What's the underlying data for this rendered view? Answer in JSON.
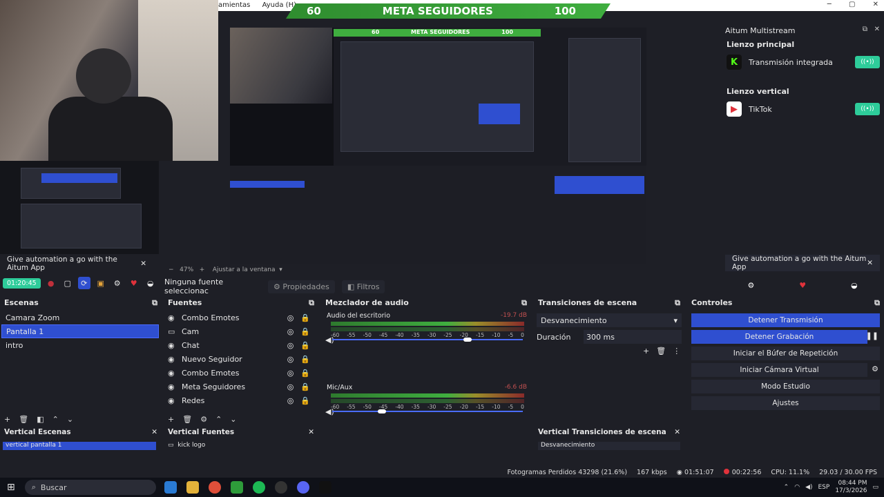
{
  "titlebar": {
    "menu": [
      "amientas",
      "Ayuda (H)"
    ],
    "min": "─",
    "max": "▢",
    "close": "✕"
  },
  "meta_banner": {
    "current": "60",
    "title": "META SEGUIDORES",
    "goal": "100"
  },
  "preview_meta": {
    "current": "60",
    "title": "META SEGUIDORES",
    "goal": "100"
  },
  "aitum": {
    "title": "Aitum Multistream",
    "main_canvas": "Lienzo principal",
    "main_item": "Transmisión integrada",
    "vertical_canvas": "Lienzo vertical",
    "vertical_item": "TikTok",
    "promo": "Give automation a go with the Aitum App",
    "toggle_icon": "((•))"
  },
  "left_promo": "Give automation a go with the Aitum App",
  "left_toolbar": {
    "live_time": "01:20:45"
  },
  "zoom": {
    "percent": "47%",
    "fit": "Ajustar a la ventana"
  },
  "source_bar": {
    "no_source": "Ninguna fuente seleccionac",
    "properties": "Propiedades",
    "filters": "Filtros"
  },
  "scenes": {
    "title": "Escenas",
    "items": [
      "Camara Zoom",
      "Pantalla 1",
      "intro"
    ],
    "selected": 1
  },
  "sources": {
    "title": "Fuentes",
    "items": [
      "Combo Emotes",
      "Cam",
      "Chat",
      "Nuevo Seguidor",
      "Combo Emotes",
      "Meta Seguidores",
      "Redes"
    ]
  },
  "mixer": {
    "title": "Mezclador de audio",
    "tracks": [
      {
        "name": "Audio del escritorio",
        "db": "-19.7 dB",
        "level": 0.72
      },
      {
        "name": "Mic/Aux",
        "db": "-6.6 dB",
        "level": 0.25
      }
    ],
    "ticks": [
      "-60",
      "-55",
      "-50",
      "-45",
      "-40",
      "-35",
      "-30",
      "-25",
      "-20",
      "-15",
      "-10",
      "-5",
      "0"
    ]
  },
  "transitions": {
    "title": "Transiciones de escena",
    "type": "Desvanecimiento",
    "duration_label": "Duración",
    "duration": "300 ms"
  },
  "controls": {
    "title": "Controles",
    "buttons": [
      "Detener Transmisión",
      "Detener Grabación",
      "Iniciar el Búfer de Repetición",
      "Iniciar Cámara Virtual",
      "Modo Estudio",
      "Ajustes"
    ]
  },
  "vertical": {
    "scenes_title": "Vertical Escenas",
    "scene_item": "vertical pantalla 1",
    "sources_title": "Vertical Fuentes",
    "source_item": "kick logo",
    "transitions_title": "Vertical Transiciones de escena",
    "transition_item": "Desvanecimiento"
  },
  "status": {
    "dropped": "Fotogramas Perdidos 43298 (21.6%)",
    "bitrate": "167 kbps",
    "stream_time": "01:51:07",
    "rec_time": "00:22:56",
    "cpu": "CPU: 11.1%",
    "fps": "29.03 / 30.00 FPS"
  },
  "taskbar": {
    "search": "Buscar",
    "lang": "ESP",
    "time": "08:44 PM",
    "date": "17/3/2026"
  },
  "colors": {
    "accent_blue": "#2f4fd0",
    "live_green": "#2ecc9a",
    "banner_green": "#3fae3f",
    "rec_red": "#e0323b"
  }
}
